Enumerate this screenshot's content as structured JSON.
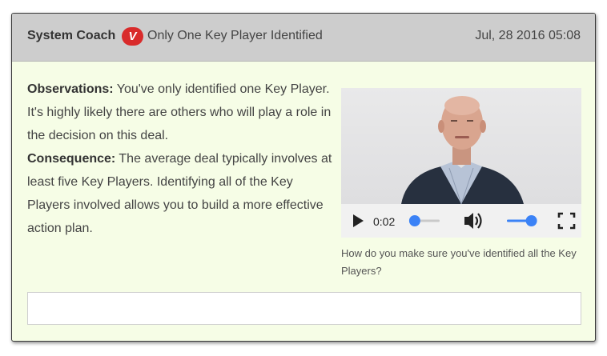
{
  "header": {
    "sender": "System Coach",
    "badge": "V",
    "subject": "Only One Key Player Identified",
    "date": "Jul, 28 2016 05:08"
  },
  "content": {
    "observations_label": "Observations:",
    "observations_text": " You've only identified one Key Player. It's highly likely there are others who will play a role in the decision on this deal.",
    "consequence_label": "Consequence:",
    "consequence_text": " The average deal typically involves at least five Key Players. Identifying all of the Key Players involved allows you to build a more effective action plan."
  },
  "video": {
    "time": "0:02",
    "progress": 0.05,
    "volume": 0.9,
    "caption": "How do you make sure you've identified all the Key Players?"
  },
  "reply": {
    "value": ""
  },
  "colors": {
    "accent": "#3b82f6",
    "badge": "#d92b2b",
    "card_bg": "#f6fde6",
    "header_bg": "#cdcdcd"
  }
}
